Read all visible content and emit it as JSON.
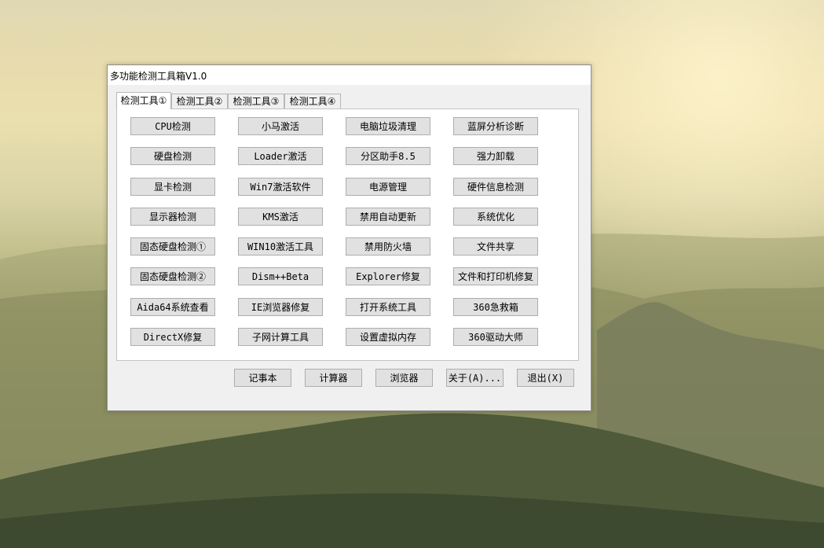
{
  "window": {
    "title": "多功能检测工具箱V1.0"
  },
  "tabs": [
    {
      "label": "检测工具①",
      "active": true
    },
    {
      "label": "检测工具②",
      "active": false
    },
    {
      "label": "检测工具③",
      "active": false
    },
    {
      "label": "检测工具④",
      "active": false
    }
  ],
  "grid": {
    "rows": [
      [
        "CPU检测",
        "小马激活",
        "电脑垃圾清理",
        "蓝屏分析诊断"
      ],
      [
        "硬盘检测",
        "Loader激活",
        "分区助手8.5",
        "强力卸载"
      ],
      [
        "显卡检测",
        "Win7激活软件",
        "电源管理",
        "硬件信息检测"
      ],
      [
        "显示器检测",
        "KMS激活",
        "禁用自动更新",
        "系统优化"
      ],
      [
        "固态硬盘检测①",
        "WIN10激活工具",
        "禁用防火墙",
        "文件共享"
      ],
      [
        "固态硬盘检测②",
        "Dism++Beta",
        "Explorer修复",
        "文件和打印机修复"
      ],
      [
        "Aida64系统查看",
        "IE浏览器修复",
        "打开系统工具",
        "360急救箱"
      ],
      [
        "DirectX修复",
        "子网计算工具",
        "设置虚拟内存",
        "360驱动大师"
      ]
    ]
  },
  "bottom_buttons": [
    "记事本",
    "计算器",
    "浏览器",
    "关于(A)...",
    "退出(X)"
  ]
}
